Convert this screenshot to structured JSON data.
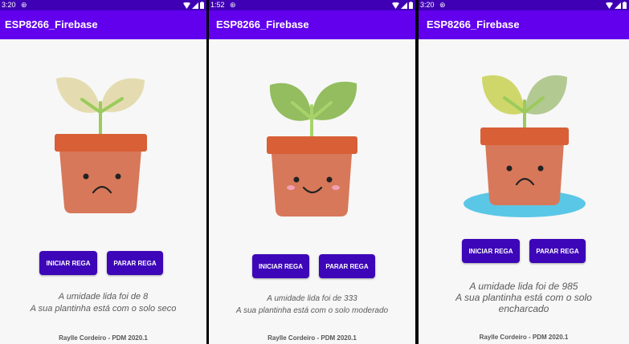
{
  "screens": [
    {
      "status_time": "3:20",
      "app_title": "ESP8266_Firebase",
      "start_button": "INICIAR REGA",
      "stop_button": "PARAR REGA",
      "humidity_line": "A umidade lida foi de 8",
      "soil_line": "A sua plantinha está com o solo seco",
      "footer": "Raylle Cordeiro - PDM 2020.1",
      "mood": "sad",
      "leaf_color": "#e4dcb0"
    },
    {
      "status_time": "1:52",
      "app_title": "ESP8266_Firebase",
      "start_button": "INICIAR REGA",
      "stop_button": "PARAR REGA",
      "humidity_line": "A umidade lida foi de 333",
      "soil_line": "A sua plantinha está com o solo moderado",
      "footer": "Raylle Cordeiro - PDM 2020.1",
      "mood": "happy",
      "leaf_color": "#93bd5e"
    },
    {
      "status_time": "3:20",
      "app_title": "ESP8266_Firebase",
      "start_button": "INICIAR REGA",
      "stop_button": "PARAR REGA",
      "humidity_line": "A umidade lida foi de 985",
      "soil_line": "A sua plantinha está com o solo encharcado",
      "footer": "Raylle Cordeiro - PDM 2020.1",
      "mood": "sad",
      "leaf_color": "#b8cc6a"
    }
  ],
  "colors": {
    "status_bar": "#3f00b5",
    "app_bar": "#6200ee",
    "button": "#3d06b8",
    "pot_body": "#d7785a",
    "pot_rim": "#d85f36",
    "stem": "#9acb5b",
    "water": "#5bc7e6"
  },
  "icons": [
    "sync-icon",
    "wifi-icon",
    "signal-icon",
    "battery-icon"
  ]
}
